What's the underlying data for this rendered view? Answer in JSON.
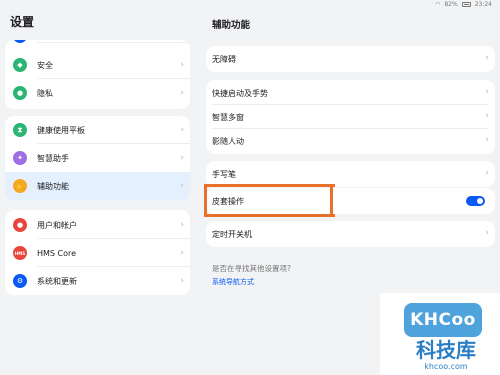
{
  "status_bar": {
    "wifi": "wifi-icon",
    "battery_percent": "82%",
    "time": "23:24"
  },
  "left_title": "设置",
  "right_title": "辅助功能",
  "left_cards": [
    {
      "items": [
        {
          "label": "安全",
          "icon": "shield-icon",
          "color": "#2bb673"
        },
        {
          "label": "隐私",
          "icon": "privacy-icon",
          "color": "#2bb673"
        }
      ]
    },
    {
      "items": [
        {
          "label": "健康使用平板",
          "icon": "hourglass-icon",
          "color": "#2bb673"
        },
        {
          "label": "智慧助手",
          "icon": "assistant-icon",
          "color": "#a16ee6"
        },
        {
          "label": "辅助功能",
          "icon": "hand-icon",
          "color": "#f5a623",
          "selected": true
        }
      ]
    },
    {
      "items": [
        {
          "label": "用户和帐户",
          "icon": "user-icon",
          "color": "#e8453c"
        },
        {
          "label": "HMS Core",
          "icon": "hms-icon",
          "color": "#e8453c",
          "glyph": "HMS"
        },
        {
          "label": "系统和更新",
          "icon": "gear-icon",
          "color": "#0a59f7"
        }
      ]
    }
  ],
  "right_cards": [
    {
      "items": [
        {
          "label": "无障碍"
        }
      ]
    },
    {
      "items": [
        {
          "label": "快捷启动及手势"
        },
        {
          "label": "智慧多窗"
        },
        {
          "label": "影随人动"
        }
      ]
    },
    {
      "items": [
        {
          "label": "手写笔"
        }
      ]
    },
    {
      "items": [
        {
          "label": "皮套操作",
          "toggle": true
        }
      ]
    },
    {
      "items": [
        {
          "label": "定时开关机"
        }
      ]
    }
  ],
  "toggle_state": "on",
  "hint": {
    "question": "是否在寻找其他设置项?",
    "link": "系统导航方式"
  },
  "watermark": {
    "logo": "KHCoo",
    "name": "科技库",
    "url": "khcoo.com"
  },
  "colors": {
    "accent": "#0a59f7",
    "highlight_frame": "#e8702a",
    "background": "#f1f3f5"
  }
}
